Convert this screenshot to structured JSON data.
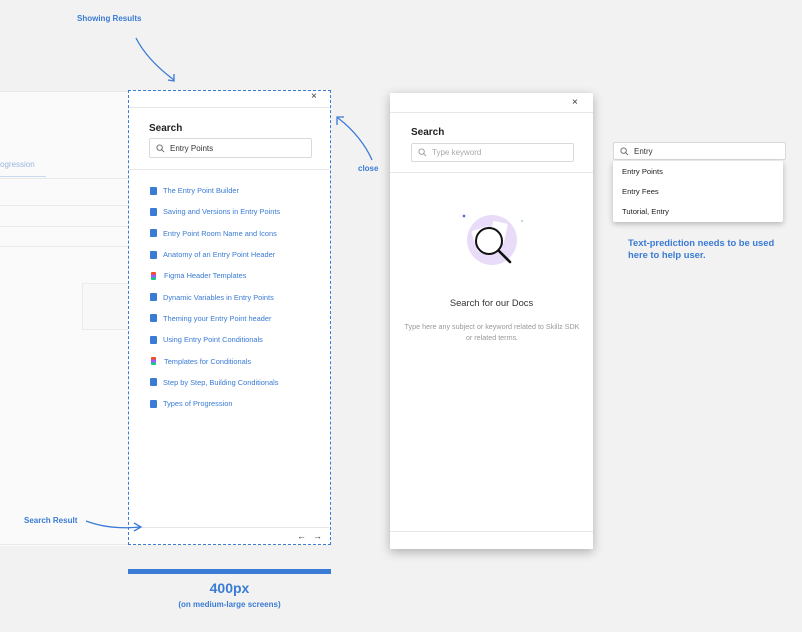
{
  "annotations": {
    "showing_results": "Showing Results",
    "close": "close",
    "search_result": "Search Result",
    "text_prediction": "Text-prediction needs to be used here to help user.",
    "width_value": "400px",
    "width_note": "(on medium-large screens)"
  },
  "background_app": {
    "tab_label": "ogression"
  },
  "results_panel": {
    "close_glyph": "×",
    "title": "Search",
    "search_value": "Entry Points",
    "items": [
      {
        "label": "The Entry Point Builder",
        "icon": "doc-icon"
      },
      {
        "label": "Saving and Versions in Entry Points",
        "icon": "doc-icon"
      },
      {
        "label": "Entry Point Room Name and Icons",
        "icon": "doc-icon"
      },
      {
        "label": "Anatomy of an Entry Point Header",
        "icon": "doc-icon"
      },
      {
        "label": "Figma Header Templates",
        "icon": "figma-icon"
      },
      {
        "label": "Dynamic Variables in Entry Points",
        "icon": "doc-icon"
      },
      {
        "label": "Theming your Entry Point header",
        "icon": "doc-icon"
      },
      {
        "label": "Using Entry Point Conditionals",
        "icon": "doc-icon"
      },
      {
        "label": "Templates for Conditionals",
        "icon": "figma-icon"
      },
      {
        "label": "Step by Step, Building Conditionals",
        "icon": "doc-icon"
      },
      {
        "label": "Types of Progression",
        "icon": "doc-icon"
      }
    ],
    "prev_glyph": "←",
    "next_glyph": "→"
  },
  "empty_panel": {
    "close_glyph": "×",
    "title": "Search",
    "placeholder": "Type keyword",
    "empty_title": "Search for our Docs",
    "empty_desc": "Type here any subject or keyword related to Skillz SDK or related terms."
  },
  "prediction": {
    "input_value": "Entry",
    "options": [
      "Entry Points",
      "Entry Fees",
      "Tutorial, Entry"
    ]
  },
  "colors": {
    "accent": "#3a7bd5",
    "background": "#f2f2f2"
  }
}
